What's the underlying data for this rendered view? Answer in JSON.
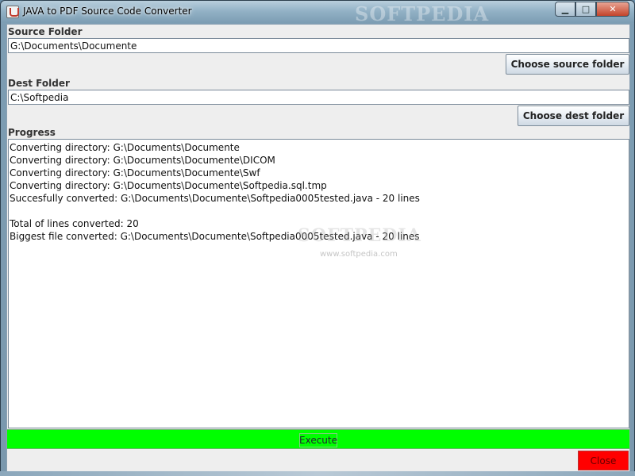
{
  "window": {
    "title": "JAVA to PDF Source Code Converter",
    "watermark": "SOFTPEDIA",
    "controls": {
      "minimize": "▁",
      "maximize": "□",
      "close": "✕"
    }
  },
  "source": {
    "label": "Source Folder",
    "value": "G:\\Documents\\Documente",
    "button": "Choose source folder"
  },
  "dest": {
    "label": "Dest Folder",
    "value": "C:\\Softpedia",
    "button": "Choose dest folder"
  },
  "progress": {
    "label": "Progress",
    "lines": [
      "Converting directory: G:\\Documents\\Documente",
      "Converting directory: G:\\Documents\\Documente\\DICOM",
      "Converting directory: G:\\Documents\\Documente\\Swf",
      "Converting directory: G:\\Documents\\Documente\\Softpedia.sql.tmp",
      "Succesfully converted: G:\\Documents\\Documente\\Softpedia0005tested.java - 20 lines",
      "",
      "Total of lines converted: 20",
      "Biggest file converted: G:\\Documents\\Documente\\Softpedia0005tested.java - 20 lines"
    ],
    "watermark": "SOFTPEDIA",
    "watermark_url": "www.softpedia.com"
  },
  "actions": {
    "execute": "Execute",
    "close": "Close"
  },
  "colors": {
    "execute_bar": "#00ff00",
    "close_button": "#ff0000"
  }
}
